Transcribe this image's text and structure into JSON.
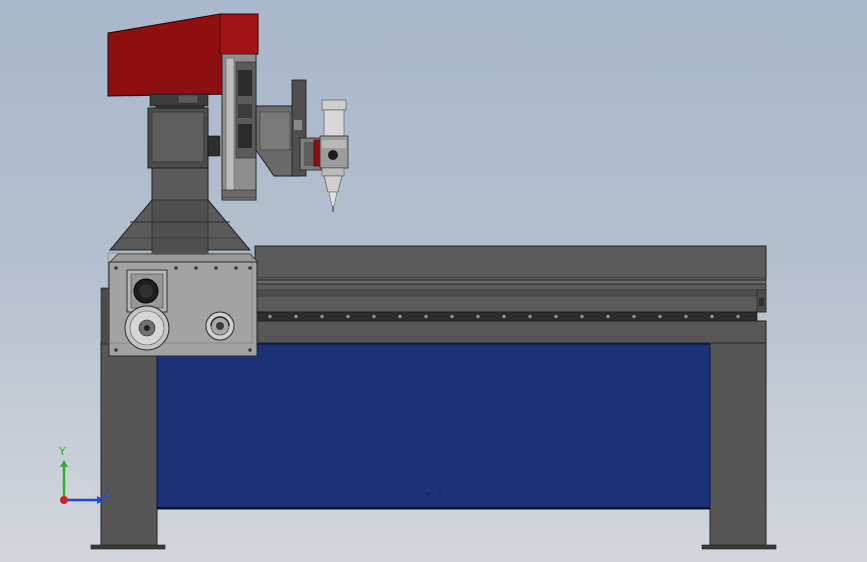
{
  "viewport": {
    "background_top": "#a9b7cc",
    "background_bottom": "#d3d7dc"
  },
  "triad": {
    "y_label": "Y",
    "z_label": "Z",
    "y_color": "#2fae3a",
    "z_color": "#2346d8",
    "x_color": "#d12020"
  },
  "colors": {
    "head_red": "#8e0f12",
    "frame_gray": "#585858",
    "frame_dark": "#3d3d3d",
    "panel_gray": "#a3a3a3",
    "table_blue": "#1b3277",
    "metal_light": "#c7c7c7"
  }
}
